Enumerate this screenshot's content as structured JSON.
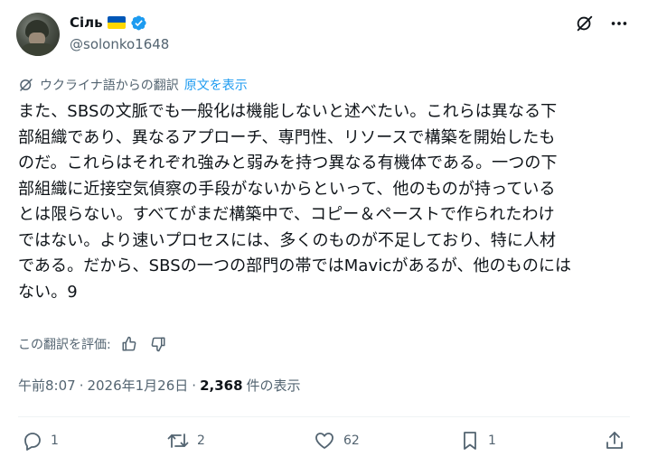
{
  "author": {
    "display_name": "Сіль",
    "handle": "@solonko1648",
    "flag": {
      "top_color": "#0057b7",
      "bottom_color": "#ffd700"
    },
    "verified_icon": "verified-badge-icon"
  },
  "top_actions": [
    {
      "icon": "grok-icon"
    },
    {
      "icon": "more-icon"
    }
  ],
  "translation": {
    "notice": "ウクライナ語からの翻訳",
    "show_original": "原文を表示"
  },
  "tweet": {
    "lines": [
      "また、SBSの文脈でも一般化は機能しないと述べたい。これらは異なる下",
      "部組織であり、異なるアプローチ、専門性、リソースで構築を開始したも",
      "のだ。これらはそれぞれ強みと弱みを持つ異なる有機体である。一つの下",
      "部組織に近接空気偵察の手段がないからといって、他のものが持っている",
      "とは限らない。すべてがまだ構築中で、コピー＆ペーストで作られたわけ",
      "ではない。より速いプロセスには、多くのものが不足しており、特に人材",
      "である。だから、SBSの一つの部門の帯ではMavicがあるが、他のものには",
      "ない。9"
    ]
  },
  "rate_translation": {
    "label": "この翻訳を評価:"
  },
  "meta": {
    "time": "午前8:07",
    "separator": "·",
    "date": "2026年1月26日",
    "views_count": "2,368",
    "views_label": "件の表示"
  },
  "actions": {
    "reply_count": "1",
    "retweet_count": "2",
    "like_count": "62",
    "bookmark_count": "1"
  },
  "colors": {
    "text": "#0f1419",
    "secondary": "#536471",
    "accent": "#1d9bf0",
    "divider": "#eff3f4"
  }
}
